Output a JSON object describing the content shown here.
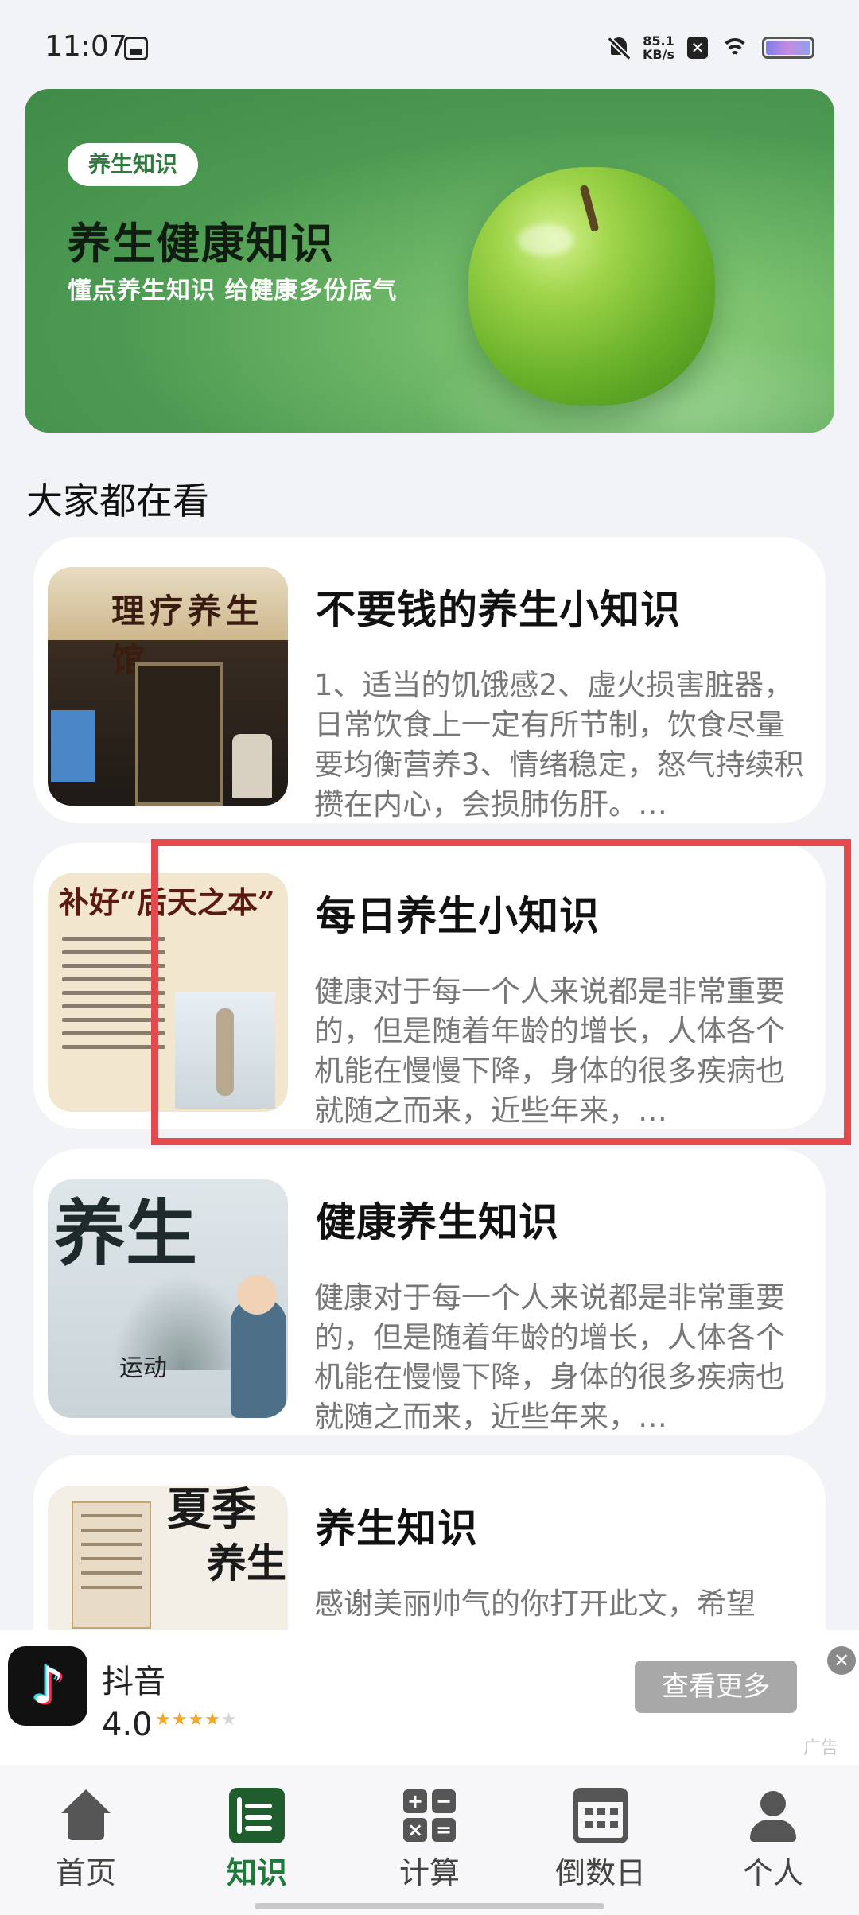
{
  "status_bar": {
    "time": "11:07",
    "net_speed_value": "85.1",
    "net_speed_unit": "KB/s"
  },
  "banner": {
    "tag": "养生知识",
    "title": "养生健康知识",
    "subtitle": "懂点养生知识  给健康多份底气"
  },
  "section_title": "大家都在看",
  "cards": [
    {
      "title": "不要钱的养生小知识",
      "description": "1、适当的饥饿感2、虚火损害脏器，日常饮食上一定有所节制，饮食尽量要均衡营养3、情绪稳定，怒气持续积攒在内心，会损肺伤肝。…",
      "thumb_text": "理疗养生馆"
    },
    {
      "title": "每日养生小知识",
      "description": "健康对于每一个人来说都是非常重要的，但是随着年龄的增长，人体各个机能在慢慢下降，身体的很多疾病也就随之而来，近些年来，…",
      "thumb_text": "补好“后天之本”"
    },
    {
      "title": "健康养生知识",
      "description": "健康对于每一个人来说都是非常重要的，但是随着年龄的增长，人体各个机能在慢慢下降，身体的很多疾病也就随之而来，近些年来，…",
      "thumb_text_big": "养生",
      "thumb_text_small": "运动"
    },
    {
      "title": "养生知识",
      "description": "感谢美丽帅气的你打开此文，希望",
      "thumb_text_big": "夏季",
      "thumb_text_big2": "养生"
    }
  ],
  "ad": {
    "app_name": "抖音",
    "rating": "4.0",
    "stars_filled": "★★★★",
    "stars_empty": "★",
    "more_button": "查看更多",
    "close": "✕",
    "label": "广告"
  },
  "nav": {
    "items": [
      {
        "label": "首页",
        "icon": "home-icon"
      },
      {
        "label": "知识",
        "icon": "book-icon",
        "active": true
      },
      {
        "label": "计算",
        "icon": "calculator-icon"
      },
      {
        "label": "倒数日",
        "icon": "calendar-icon"
      },
      {
        "label": "个人",
        "icon": "person-icon"
      }
    ]
  },
  "colors": {
    "accent": "#1f7a3a",
    "highlight": "#e5484d",
    "background": "#f2f3f7"
  }
}
